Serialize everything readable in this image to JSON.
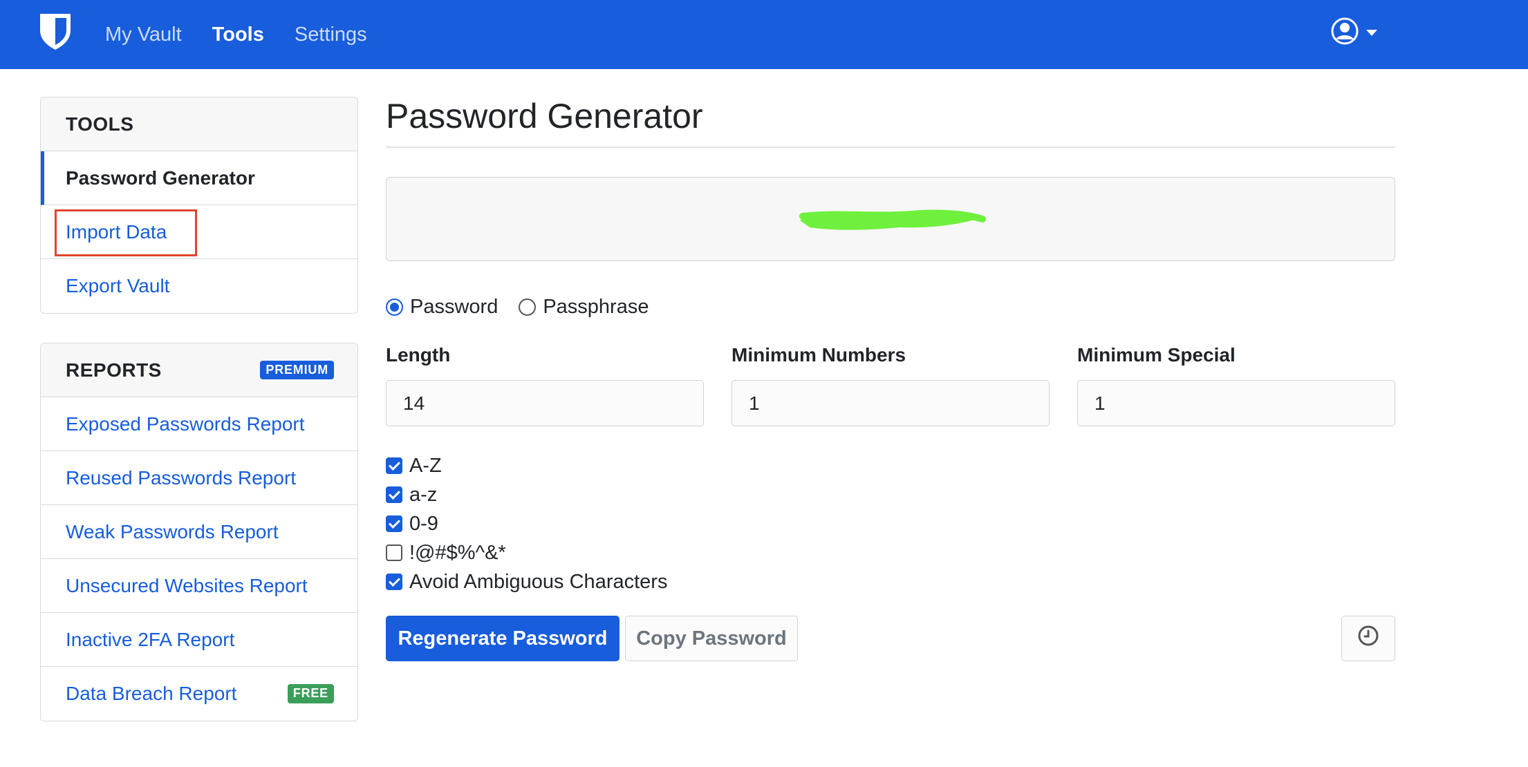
{
  "nav": {
    "brand_icon": "bitwarden-shield-icon",
    "links": [
      {
        "label": "My Vault",
        "active": false
      },
      {
        "label": "Tools",
        "active": true
      },
      {
        "label": "Settings",
        "active": false
      }
    ],
    "account_icon": "user-circle-icon"
  },
  "sidebar": {
    "tools": {
      "header": "TOOLS",
      "items": [
        {
          "label": "Password Generator",
          "active": true
        },
        {
          "label": "Import Data",
          "highlighted": true
        },
        {
          "label": "Export Vault"
        }
      ]
    },
    "reports": {
      "header": "REPORTS",
      "badge": "PREMIUM",
      "items": [
        {
          "label": "Exposed Passwords Report"
        },
        {
          "label": "Reused Passwords Report"
        },
        {
          "label": "Weak Passwords Report"
        },
        {
          "label": "Unsecured Websites Report"
        },
        {
          "label": "Inactive 2FA Report"
        },
        {
          "label": "Data Breach Report",
          "badge": "FREE"
        }
      ]
    }
  },
  "main": {
    "title": "Password Generator",
    "generated_password": "",
    "type_options": [
      {
        "label": "Password",
        "checked": true
      },
      {
        "label": "Passphrase",
        "checked": false
      }
    ],
    "fields": [
      {
        "label": "Length",
        "value": "14"
      },
      {
        "label": "Minimum Numbers",
        "value": "1"
      },
      {
        "label": "Minimum Special",
        "value": "1"
      }
    ],
    "options": [
      {
        "label": "A-Z",
        "checked": true
      },
      {
        "label": "a-z",
        "checked": true
      },
      {
        "label": "0-9",
        "checked": true
      },
      {
        "label": "!@#$%^&*",
        "checked": false
      },
      {
        "label": "Avoid Ambiguous Characters",
        "checked": true
      }
    ],
    "regenerate_label": "Regenerate Password",
    "copy_label": "Copy Password",
    "history_icon": "clock-history-icon"
  },
  "colors": {
    "primary": "#175ddc",
    "highlight_box": "#e0442e",
    "redaction": "#6ef03c",
    "free_badge": "#3b9e5a"
  }
}
